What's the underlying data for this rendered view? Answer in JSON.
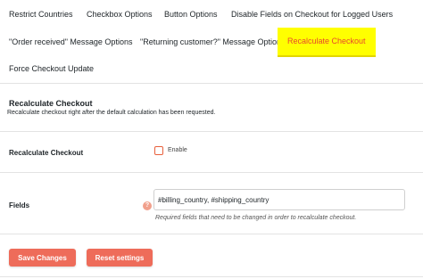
{
  "tabs": [
    {
      "label": "Restrict Countries"
    },
    {
      "label": "Checkbox Options"
    },
    {
      "label": "Button Options"
    },
    {
      "label": "Disable Fields on Checkout for Logged Users"
    },
    {
      "label": "\"Order received\" Message Options"
    },
    {
      "label": "\"Returning customer?\" Message Options"
    },
    {
      "label": "Recalculate Checkout",
      "active": true
    },
    {
      "label": "Force Checkout Update"
    }
  ],
  "section": {
    "title": "Recalculate Checkout",
    "description": "Recalculate checkout right after the default calculation has been requested."
  },
  "recalculate": {
    "label": "Recalculate Checkout",
    "checkbox_label": "Enable",
    "checked": false
  },
  "fields": {
    "label": "Fields",
    "value": "#billing_country, #shipping_country",
    "description": "Required fields that need to be changed in order to recalculate checkout.",
    "help_glyph": "?"
  },
  "buttons": {
    "save_label": "Save Changes",
    "reset_label": "Reset settings"
  },
  "colors": {
    "accent": "#ee6c5a",
    "active_tab_bg": "#ffff00",
    "active_tab_text": "#e8482c"
  }
}
